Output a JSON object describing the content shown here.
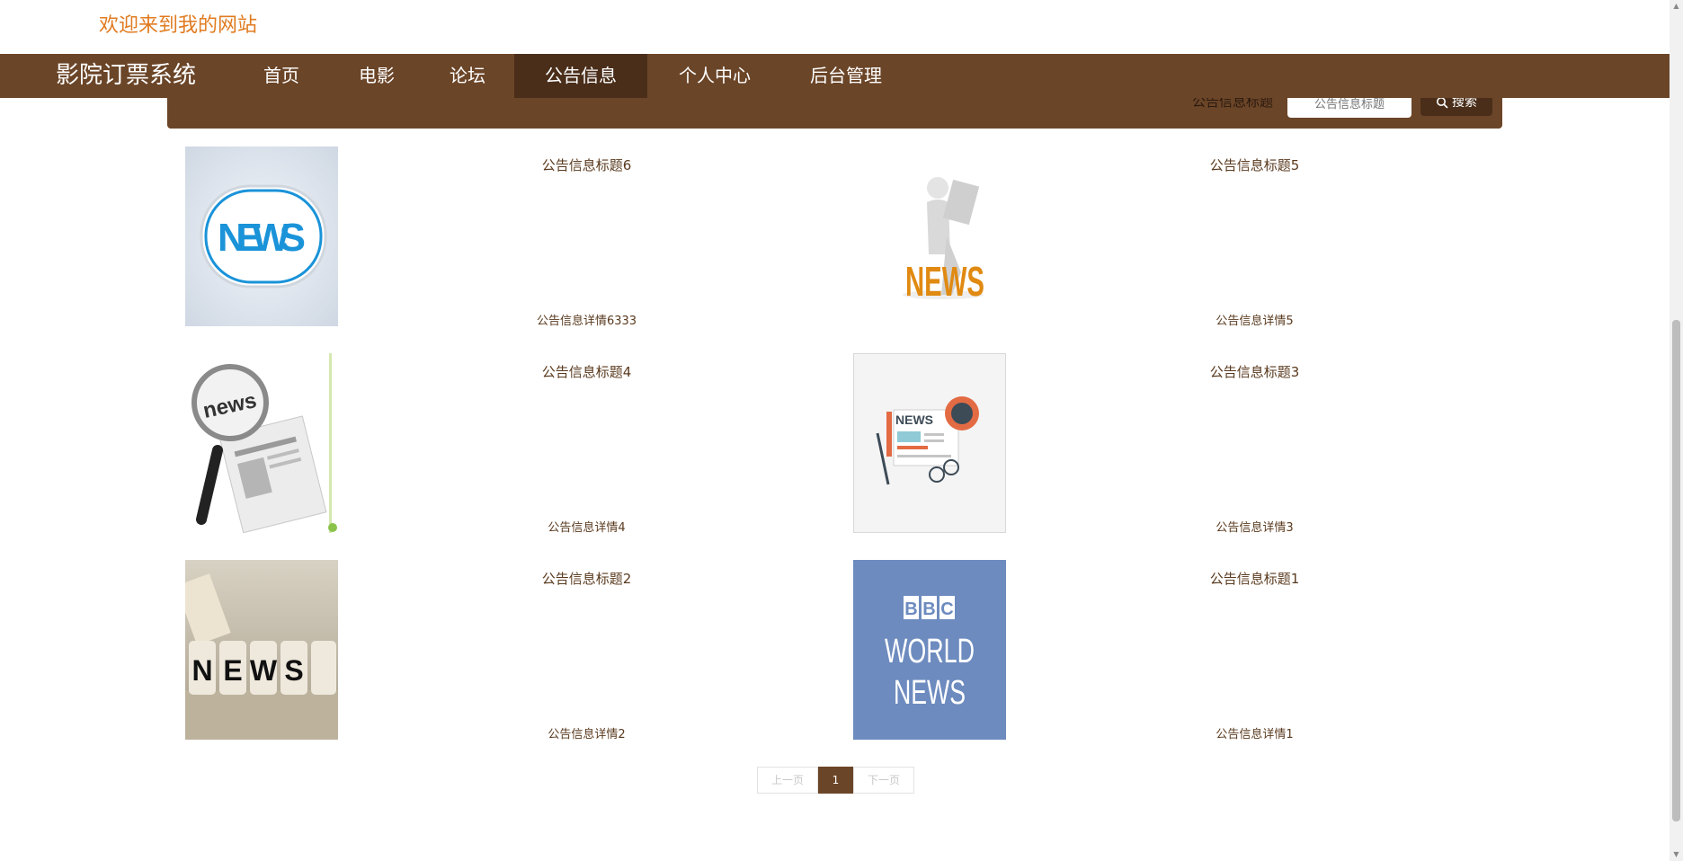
{
  "header": {
    "welcome": "欢迎来到我的网站"
  },
  "nav": {
    "brand": "影院订票系统",
    "items": [
      {
        "label": "首页",
        "active": false
      },
      {
        "label": "电影",
        "active": false
      },
      {
        "label": "论坛",
        "active": false
      },
      {
        "label": "公告信息",
        "active": true
      },
      {
        "label": "个人中心",
        "active": false
      },
      {
        "label": "后台管理",
        "active": false
      }
    ]
  },
  "search": {
    "label": "公告信息标题",
    "placeholder": "公告信息标题",
    "button": "搜索",
    "icon": "search-icon"
  },
  "cards": [
    {
      "title": "公告信息标题6",
      "detail": "公告信息详情6333",
      "image": "news-badge"
    },
    {
      "title": "公告信息标题5",
      "detail": "公告信息详情5",
      "image": "news-reader"
    },
    {
      "title": "公告信息标题4",
      "detail": "公告信息详情4",
      "image": "news-magnifier"
    },
    {
      "title": "公告信息标题3",
      "detail": "公告信息详情3",
      "image": "news-illustration"
    },
    {
      "title": "公告信息标题2",
      "detail": "公告信息详情2",
      "image": "news-cubes"
    },
    {
      "title": "公告信息标题1",
      "detail": "公告信息详情1",
      "image": "bbc-world-news"
    }
  ],
  "pagination": {
    "prev": "上一页",
    "current": "1",
    "next": "下一页"
  },
  "colors": {
    "primary": "#6b4528",
    "active": "#4a2e1a",
    "welcome": "#e07b20",
    "text": "#5a3a1e"
  }
}
